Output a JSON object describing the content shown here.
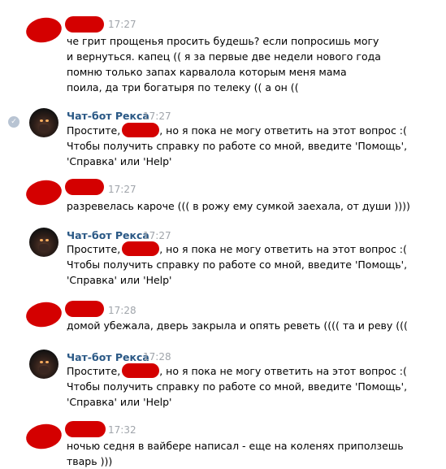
{
  "messages": [
    {
      "time": "17:27",
      "text": "че грит прощенья просить будешь? если попросишь могу и вернуться. капец (( я за первые две недели нового года помню только запах карвалола которым меня мама поила, да три богатыря по телеку (( а он (("
    },
    {
      "sender": "Чат-бот Рекса",
      "time": "17:27",
      "text_before": "Простите,",
      "text_after": ", но я пока не могу ответить на этот вопрос :(\nЧтобы получить справку по работе со мной, введите 'Помощь',\n'Справка' или 'Help'"
    },
    {
      "time": "17:27",
      "text": "разревелась кароче ((( в рожу ему сумкой заехала, от души ))))"
    },
    {
      "sender": "Чат-бот Рекса",
      "time": "17:27",
      "text_before": "Простите,",
      "text_after": ", но я пока не могу ответить на этот вопрос :(\nЧтобы получить справку по работе со мной, введите 'Помощь',\n'Справка' или 'Help'"
    },
    {
      "time": "17:28",
      "text": "домой убежала, дверь закрыла и опять реветь (((( та и реву ((("
    },
    {
      "sender": "Чат-бот Рекса",
      "time": "17:28",
      "text_before": "Простите,",
      "text_after": ", но я пока не могу ответить на этот вопрос :(\nЧтобы получить справку по работе со мной, введите 'Помощь',\n'Справка' или 'Help'"
    },
    {
      "time": "17:32",
      "text": "ночью седня в вайбере написал - еще на коленях приползешь\nтварь )))"
    }
  ]
}
